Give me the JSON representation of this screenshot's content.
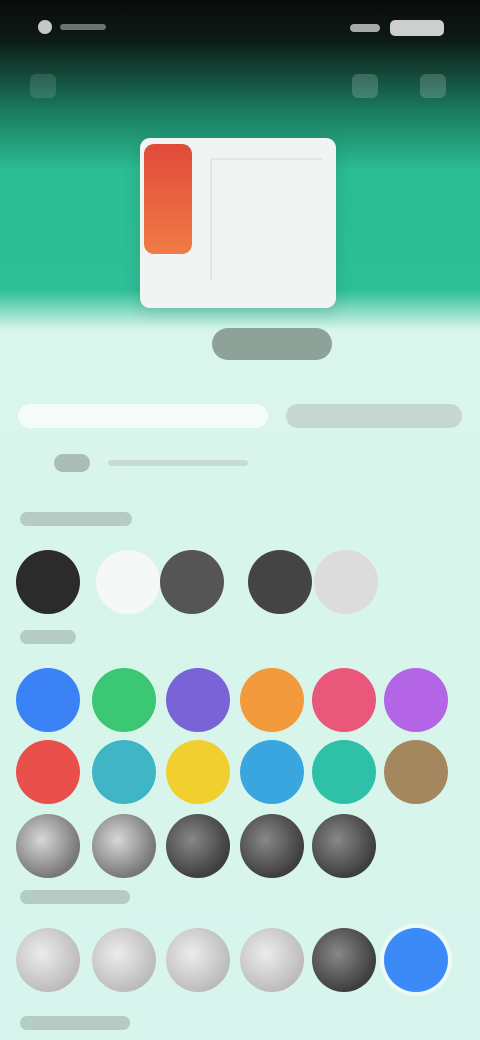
{
  "screen": "cover-color-picker",
  "colors": {
    "header_gradient_top": "#0a0c0b",
    "header_green": "#2ebf96",
    "background": "#d7f5ec",
    "preview_spine": "#e04a3a"
  },
  "tabs": [
    {
      "label": "",
      "state": "active"
    },
    {
      "label": "",
      "state": "inactive"
    }
  ],
  "sections": [
    {
      "name": "basic",
      "swatches": [
        {
          "icon": "black-swatch",
          "color": "#2b2b2b"
        },
        {
          "icon": "white-swatch",
          "color": "#f6f7f7"
        },
        {
          "icon": "brush-dark-swatch",
          "color": "#555555"
        },
        {
          "icon": "brush-dark-swatch-2",
          "color": "#444444"
        },
        {
          "icon": "light-gray-swatch",
          "color": "#dcdcdc"
        }
      ]
    },
    {
      "name": "colors",
      "swatches": [
        {
          "color": "#3b82f6"
        },
        {
          "color": "#3cc774"
        },
        {
          "color": "#7a63d6"
        },
        {
          "color": "#f39a3c"
        },
        {
          "color": "#e9577a"
        },
        {
          "color": "#b365e6"
        },
        {
          "color": "#e9504c"
        },
        {
          "color": "#3fb5c6"
        },
        {
          "color": "#f0cf2f"
        },
        {
          "color": "#3aa6e0"
        },
        {
          "color": "#2fc0a8"
        },
        {
          "color": "#a4875f"
        }
      ]
    },
    {
      "name": "textures-row",
      "swatches": [
        {
          "icon": "texture-gray"
        },
        {
          "icon": "texture-gray-2"
        },
        {
          "icon": "texture-dark"
        },
        {
          "icon": "texture-dark-2"
        },
        {
          "icon": "texture-dark-3"
        }
      ]
    },
    {
      "name": "patterns",
      "swatches": [
        {
          "icon": "pattern-1"
        },
        {
          "icon": "pattern-2"
        },
        {
          "icon": "pattern-3"
        },
        {
          "icon": "pattern-4"
        },
        {
          "icon": "pattern-5"
        },
        {
          "icon": "blue-selected-swatch",
          "color": "#3b8af7",
          "selected": true
        }
      ]
    }
  ]
}
